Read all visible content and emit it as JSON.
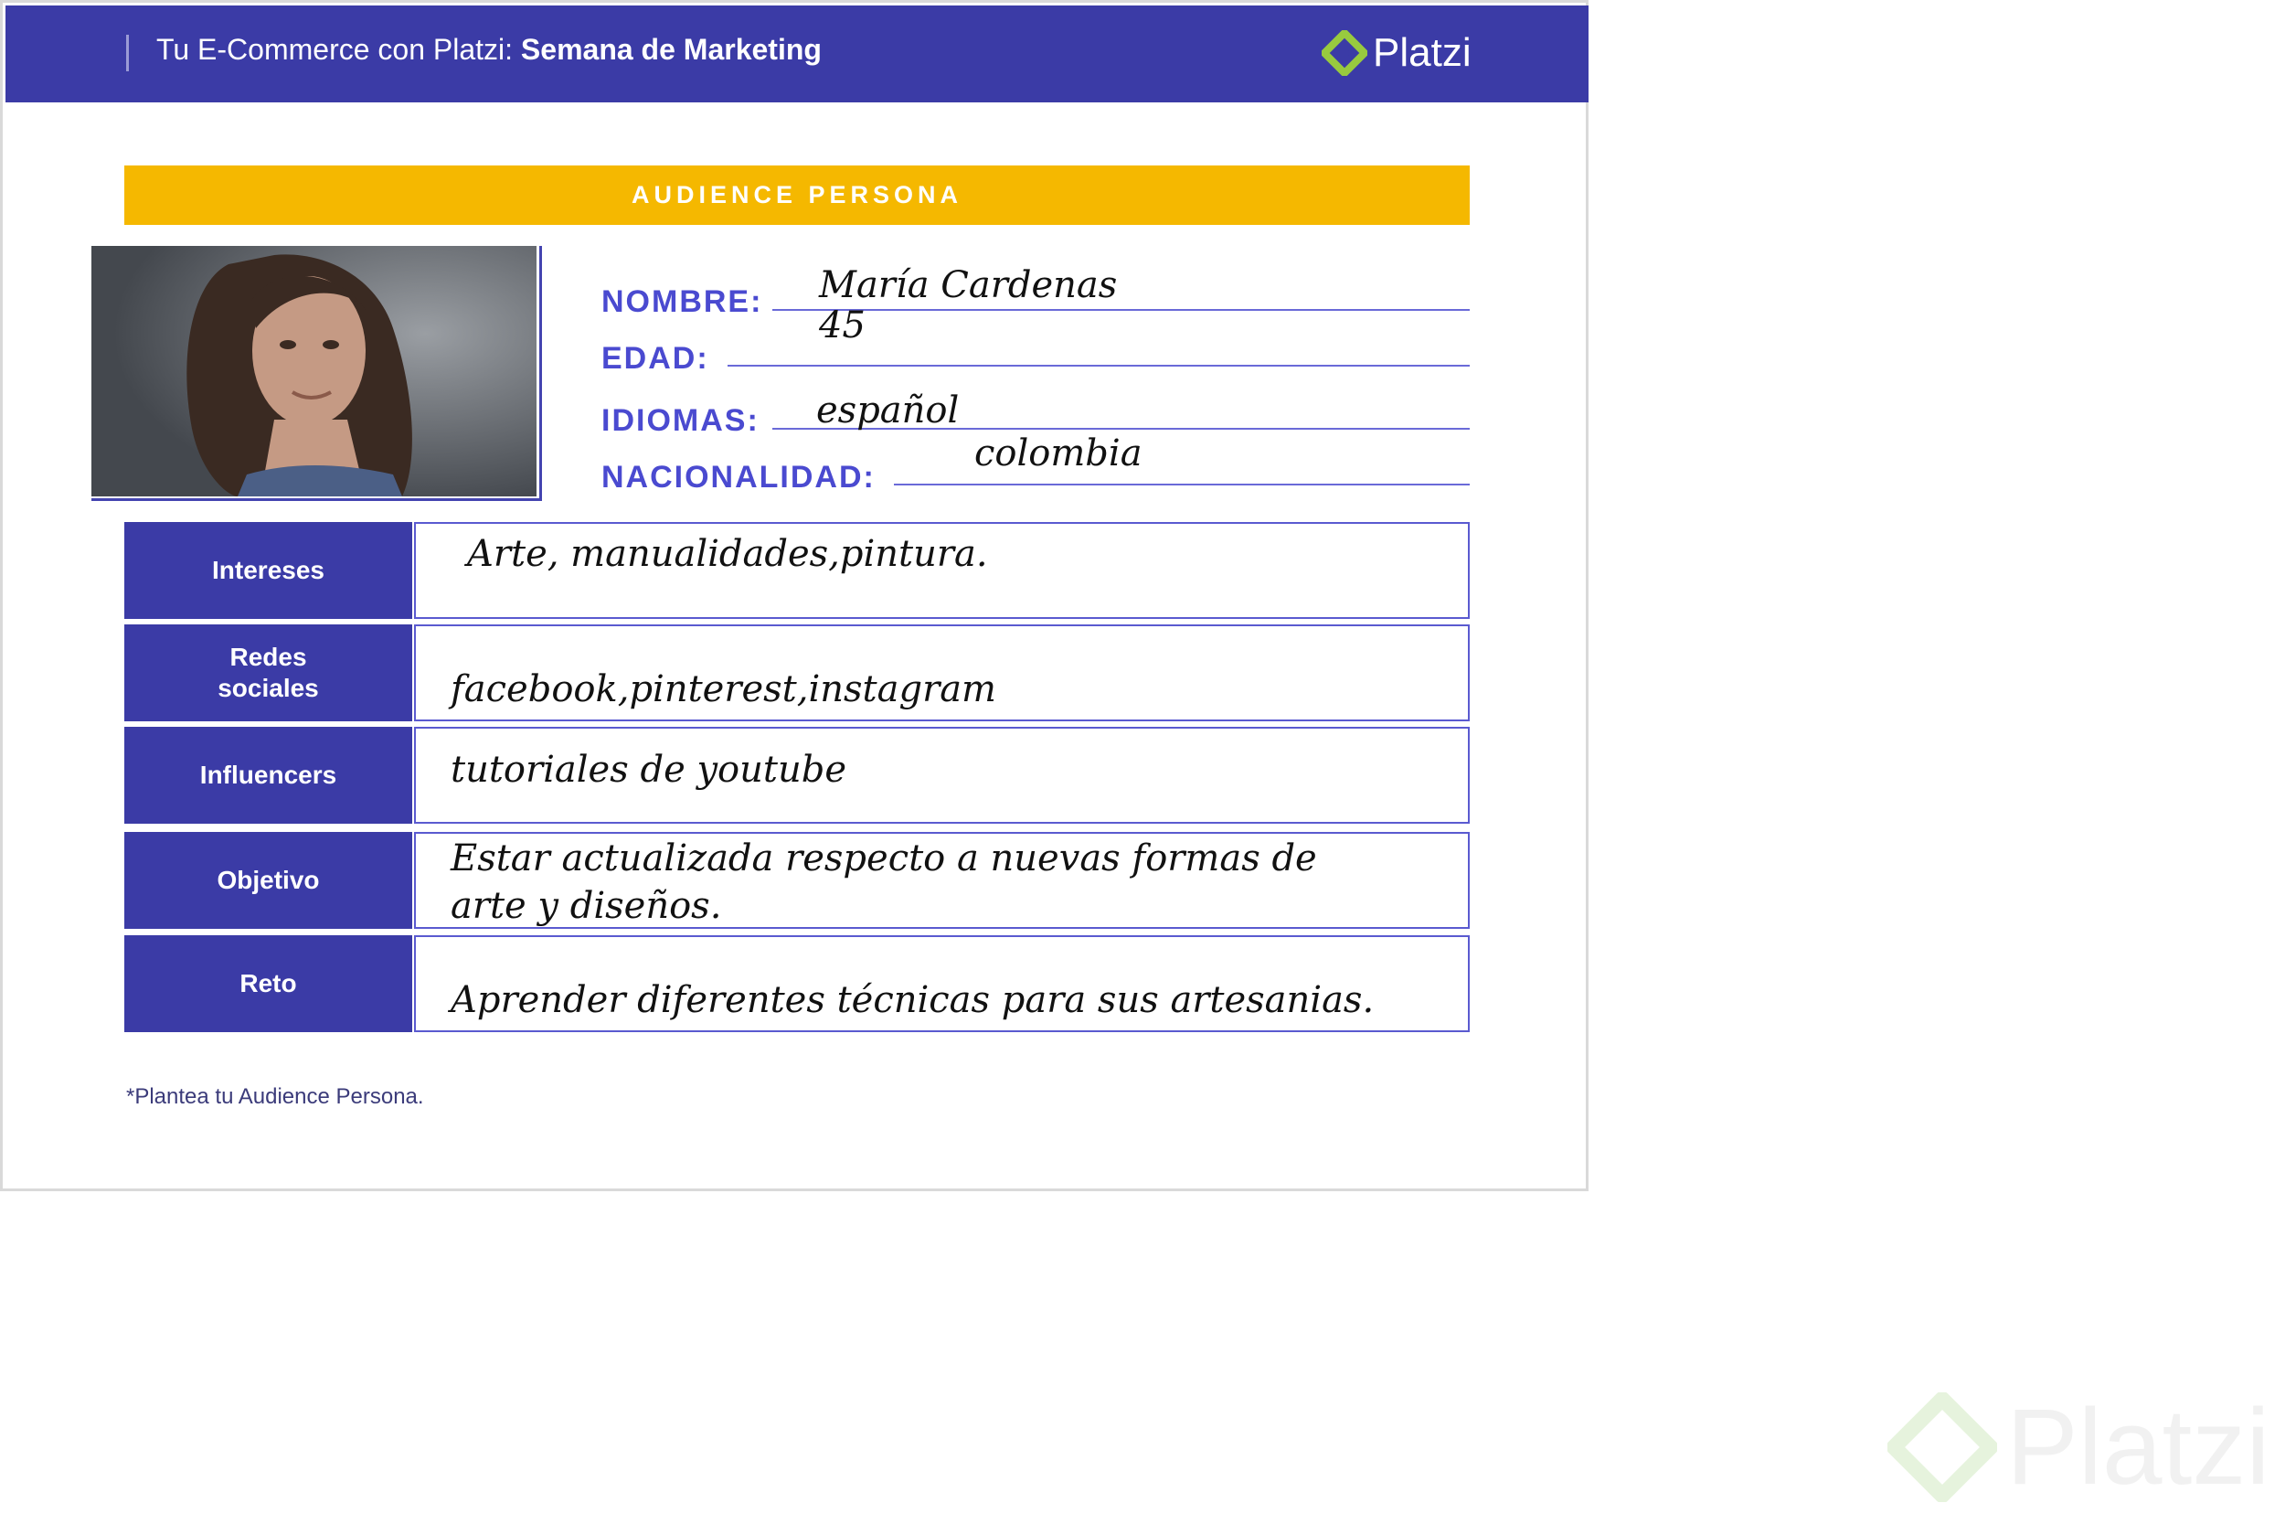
{
  "header": {
    "title_regular": "Tu E-Commerce con Platzi: ",
    "title_bold": "Semana de Marketing",
    "brand": "Platzi"
  },
  "banner": "AUDIENCE PERSONA",
  "fields": {
    "nombre_label": "NOMBRE:",
    "nombre_value": "María Cardenas",
    "edad_label": "EDAD:",
    "edad_value": "45",
    "idiomas_label": "IDIOMAS:",
    "idiomas_value": "español",
    "nacionalidad_label": "NACIONALIDAD:",
    "nacionalidad_value": "colombia"
  },
  "rows": [
    {
      "label": "Intereses",
      "value": "Arte, manualidades,pintura."
    },
    {
      "label_line1": "Redes",
      "label_line2": "sociales",
      "value": "facebook,pinterest,instagram"
    },
    {
      "label": "Influencers",
      "value": "tutoriales de youtube"
    },
    {
      "label": "Objetivo",
      "value_line1": "Estar actualizada respecto a nuevas formas de",
      "value_line2": "arte y diseños."
    },
    {
      "label": "Reto",
      "value": "Aprender diferentes técnicas para sus artesanias."
    }
  ],
  "note": "*Plantea tu Audience Persona.",
  "watermark": "Platzi",
  "colors": {
    "header_bg": "#3b3ba6",
    "banner_bg": "#f5b800",
    "label_text": "#4a4ad0",
    "logo_green": "#98ca3f"
  }
}
